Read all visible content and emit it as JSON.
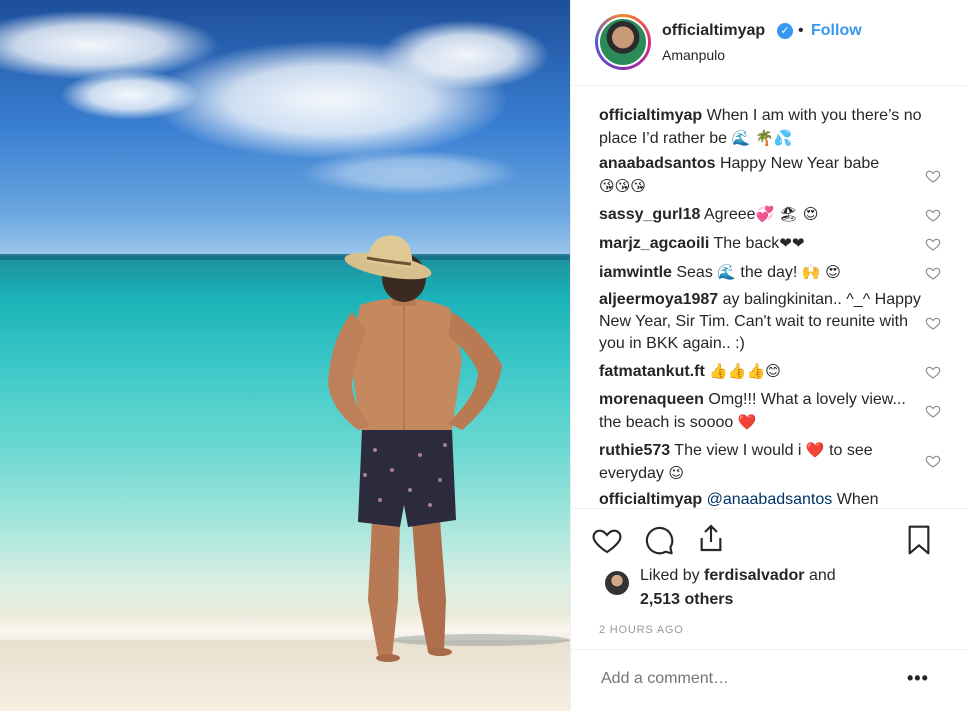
{
  "post": {
    "username": "officialtimyap",
    "verified_badge": "verified-badge-icon",
    "separator": "•",
    "follow_label": "Follow",
    "location": "Amanpulo"
  },
  "comments": [
    {
      "user": "officialtimyap",
      "text": "When I am with you there’s no place I’d rather be",
      "emoji": "🌊 🌴💦"
    },
    {
      "user": "anaabadsantos",
      "text": "Happy New Year babe",
      "emoji": "😘😘😘"
    },
    {
      "user": "sassy_gurl18",
      "text": "Agreee",
      "emoji": "💞 🏖 😍"
    },
    {
      "user": "marjz_agcaoili",
      "text": "The back",
      "emoji": "❤❤"
    },
    {
      "user": "iamwintle",
      "text": "Seas",
      "text2": "the day!",
      "emoji": "🌊",
      "emoji2": "🙌 😍"
    },
    {
      "user": "aljeermoya1987",
      "text": "ay balingkinitan.. ^_^ Happy New Year, Sir Tim. Can't wait to reunite with you in BKK again.. :)"
    },
    {
      "user": "fatmatankut.ft",
      "text": "",
      "emoji": "👍👍👍😊"
    },
    {
      "user": "morenaqueen",
      "text": "Omg!!! What a lovely view... the beach is soooo",
      "emoji": "❤️"
    },
    {
      "user": "ruthie573",
      "text": "The view I would i",
      "text2": "to see everyday",
      "emoji": "❤️",
      "emoji2": "😉"
    },
    {
      "user": "officialtimyap",
      "mention": "@anaabadsantos",
      "text": "When"
    }
  ],
  "actions": {
    "like_icon": "heart-icon",
    "comment_icon": "comment-icon",
    "share_icon": "share-icon",
    "save_icon": "bookmark-icon"
  },
  "likes": {
    "prefix": "Liked by",
    "liker": "ferdisalvador",
    "and": "and",
    "others": "2,513 others"
  },
  "timestamp": "2 HOURS AGO",
  "add_comment": {
    "placeholder": "Add a comment…",
    "more_label": "•••"
  },
  "colors": {
    "accent": "#3897f0",
    "text": "#262626",
    "muted": "#999999",
    "border": "#efefef"
  }
}
